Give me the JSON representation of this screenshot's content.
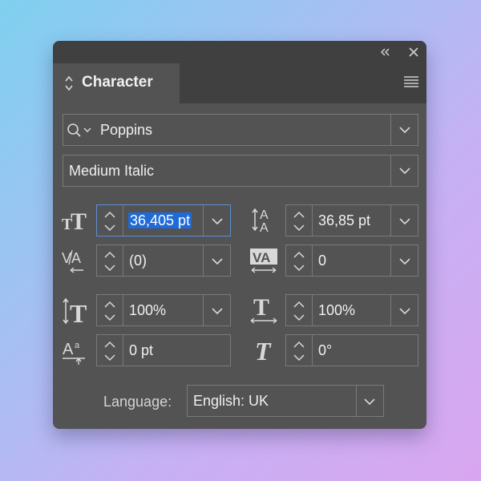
{
  "panel": {
    "collapse_icon": "double-chevron-left-icon",
    "close_icon": "close-icon",
    "tab_label": "Character",
    "menu_icon": "hamburger-menu-icon"
  },
  "font": {
    "family": "Poppins",
    "style": "Medium Italic"
  },
  "controls": {
    "font_size": "36,405 pt",
    "leading": "36,85 pt",
    "kerning": "(0)",
    "tracking": "0",
    "vertical_scale": "100%",
    "horizontal_scale": "100%",
    "baseline_shift": "0 pt",
    "skew": "0°"
  },
  "language": {
    "label": "Language:",
    "value": "English: UK"
  },
  "colors": {
    "panel_bg": "#535353",
    "header_bg": "#404040",
    "border": "#7a7a7a",
    "selection": "#1e6ad8",
    "text": "#f0f0f0"
  }
}
